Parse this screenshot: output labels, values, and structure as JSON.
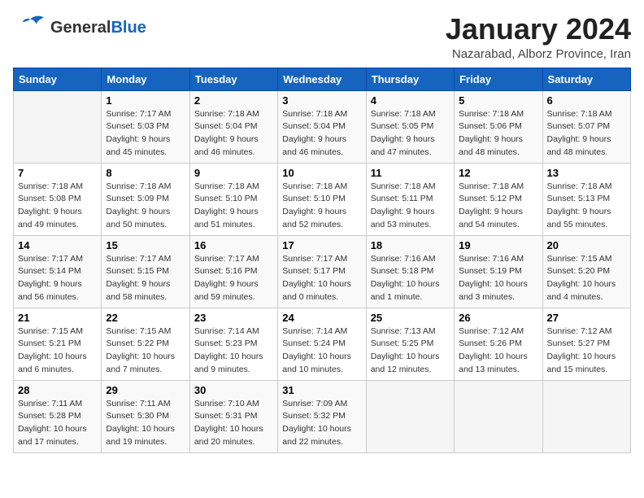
{
  "header": {
    "logo_general": "General",
    "logo_blue": "Blue",
    "month_title": "January 2024",
    "location": "Nazarabad, Alborz Province, Iran"
  },
  "weekdays": [
    "Sunday",
    "Monday",
    "Tuesday",
    "Wednesday",
    "Thursday",
    "Friday",
    "Saturday"
  ],
  "weeks": [
    [
      {
        "day": "",
        "sunrise": "",
        "sunset": "",
        "daylight": ""
      },
      {
        "day": "1",
        "sunrise": "Sunrise: 7:17 AM",
        "sunset": "Sunset: 5:03 PM",
        "daylight": "Daylight: 9 hours and 45 minutes."
      },
      {
        "day": "2",
        "sunrise": "Sunrise: 7:18 AM",
        "sunset": "Sunset: 5:04 PM",
        "daylight": "Daylight: 9 hours and 46 minutes."
      },
      {
        "day": "3",
        "sunrise": "Sunrise: 7:18 AM",
        "sunset": "Sunset: 5:04 PM",
        "daylight": "Daylight: 9 hours and 46 minutes."
      },
      {
        "day": "4",
        "sunrise": "Sunrise: 7:18 AM",
        "sunset": "Sunset: 5:05 PM",
        "daylight": "Daylight: 9 hours and 47 minutes."
      },
      {
        "day": "5",
        "sunrise": "Sunrise: 7:18 AM",
        "sunset": "Sunset: 5:06 PM",
        "daylight": "Daylight: 9 hours and 48 minutes."
      },
      {
        "day": "6",
        "sunrise": "Sunrise: 7:18 AM",
        "sunset": "Sunset: 5:07 PM",
        "daylight": "Daylight: 9 hours and 48 minutes."
      }
    ],
    [
      {
        "day": "7",
        "sunrise": "Sunrise: 7:18 AM",
        "sunset": "Sunset: 5:08 PM",
        "daylight": "Daylight: 9 hours and 49 minutes."
      },
      {
        "day": "8",
        "sunrise": "Sunrise: 7:18 AM",
        "sunset": "Sunset: 5:09 PM",
        "daylight": "Daylight: 9 hours and 50 minutes."
      },
      {
        "day": "9",
        "sunrise": "Sunrise: 7:18 AM",
        "sunset": "Sunset: 5:10 PM",
        "daylight": "Daylight: 9 hours and 51 minutes."
      },
      {
        "day": "10",
        "sunrise": "Sunrise: 7:18 AM",
        "sunset": "Sunset: 5:10 PM",
        "daylight": "Daylight: 9 hours and 52 minutes."
      },
      {
        "day": "11",
        "sunrise": "Sunrise: 7:18 AM",
        "sunset": "Sunset: 5:11 PM",
        "daylight": "Daylight: 9 hours and 53 minutes."
      },
      {
        "day": "12",
        "sunrise": "Sunrise: 7:18 AM",
        "sunset": "Sunset: 5:12 PM",
        "daylight": "Daylight: 9 hours and 54 minutes."
      },
      {
        "day": "13",
        "sunrise": "Sunrise: 7:18 AM",
        "sunset": "Sunset: 5:13 PM",
        "daylight": "Daylight: 9 hours and 55 minutes."
      }
    ],
    [
      {
        "day": "14",
        "sunrise": "Sunrise: 7:17 AM",
        "sunset": "Sunset: 5:14 PM",
        "daylight": "Daylight: 9 hours and 56 minutes."
      },
      {
        "day": "15",
        "sunrise": "Sunrise: 7:17 AM",
        "sunset": "Sunset: 5:15 PM",
        "daylight": "Daylight: 9 hours and 58 minutes."
      },
      {
        "day": "16",
        "sunrise": "Sunrise: 7:17 AM",
        "sunset": "Sunset: 5:16 PM",
        "daylight": "Daylight: 9 hours and 59 minutes."
      },
      {
        "day": "17",
        "sunrise": "Sunrise: 7:17 AM",
        "sunset": "Sunset: 5:17 PM",
        "daylight": "Daylight: 10 hours and 0 minutes."
      },
      {
        "day": "18",
        "sunrise": "Sunrise: 7:16 AM",
        "sunset": "Sunset: 5:18 PM",
        "daylight": "Daylight: 10 hours and 1 minute."
      },
      {
        "day": "19",
        "sunrise": "Sunrise: 7:16 AM",
        "sunset": "Sunset: 5:19 PM",
        "daylight": "Daylight: 10 hours and 3 minutes."
      },
      {
        "day": "20",
        "sunrise": "Sunrise: 7:15 AM",
        "sunset": "Sunset: 5:20 PM",
        "daylight": "Daylight: 10 hours and 4 minutes."
      }
    ],
    [
      {
        "day": "21",
        "sunrise": "Sunrise: 7:15 AM",
        "sunset": "Sunset: 5:21 PM",
        "daylight": "Daylight: 10 hours and 6 minutes."
      },
      {
        "day": "22",
        "sunrise": "Sunrise: 7:15 AM",
        "sunset": "Sunset: 5:22 PM",
        "daylight": "Daylight: 10 hours and 7 minutes."
      },
      {
        "day": "23",
        "sunrise": "Sunrise: 7:14 AM",
        "sunset": "Sunset: 5:23 PM",
        "daylight": "Daylight: 10 hours and 9 minutes."
      },
      {
        "day": "24",
        "sunrise": "Sunrise: 7:14 AM",
        "sunset": "Sunset: 5:24 PM",
        "daylight": "Daylight: 10 hours and 10 minutes."
      },
      {
        "day": "25",
        "sunrise": "Sunrise: 7:13 AM",
        "sunset": "Sunset: 5:25 PM",
        "daylight": "Daylight: 10 hours and 12 minutes."
      },
      {
        "day": "26",
        "sunrise": "Sunrise: 7:12 AM",
        "sunset": "Sunset: 5:26 PM",
        "daylight": "Daylight: 10 hours and 13 minutes."
      },
      {
        "day": "27",
        "sunrise": "Sunrise: 7:12 AM",
        "sunset": "Sunset: 5:27 PM",
        "daylight": "Daylight: 10 hours and 15 minutes."
      }
    ],
    [
      {
        "day": "28",
        "sunrise": "Sunrise: 7:11 AM",
        "sunset": "Sunset: 5:28 PM",
        "daylight": "Daylight: 10 hours and 17 minutes."
      },
      {
        "day": "29",
        "sunrise": "Sunrise: 7:11 AM",
        "sunset": "Sunset: 5:30 PM",
        "daylight": "Daylight: 10 hours and 19 minutes."
      },
      {
        "day": "30",
        "sunrise": "Sunrise: 7:10 AM",
        "sunset": "Sunset: 5:31 PM",
        "daylight": "Daylight: 10 hours and 20 minutes."
      },
      {
        "day": "31",
        "sunrise": "Sunrise: 7:09 AM",
        "sunset": "Sunset: 5:32 PM",
        "daylight": "Daylight: 10 hours and 22 minutes."
      },
      {
        "day": "",
        "sunrise": "",
        "sunset": "",
        "daylight": ""
      },
      {
        "day": "",
        "sunrise": "",
        "sunset": "",
        "daylight": ""
      },
      {
        "day": "",
        "sunrise": "",
        "sunset": "",
        "daylight": ""
      }
    ]
  ]
}
